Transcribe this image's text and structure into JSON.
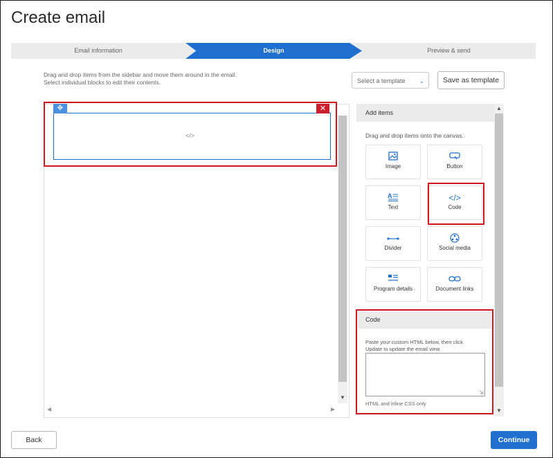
{
  "page": {
    "title": "Create email"
  },
  "stepper": {
    "steps": [
      {
        "label": "Email information"
      },
      {
        "label": "Design"
      },
      {
        "label": "Preview & send"
      }
    ]
  },
  "toolbar": {
    "hint_line1": "Drag and drop items from the sidebar and move them around in the email.",
    "hint_line2": "Select individual blocks to edit their contents.",
    "template_select": "Select a template",
    "save_template": "Save as template"
  },
  "canvas": {
    "block_glyph": "</>",
    "move_glyph": "✥",
    "delete_glyph": "✕"
  },
  "sidebar": {
    "add_items_title": "Add items",
    "drag_hint": "Drag and drop items onto the canvas.",
    "items": [
      {
        "label": "Image",
        "icon": "image-icon"
      },
      {
        "label": "Button",
        "icon": "button-icon"
      },
      {
        "label": "Text",
        "icon": "text-icon"
      },
      {
        "label": "Code",
        "icon": "code-icon"
      },
      {
        "label": "Divider",
        "icon": "divider-icon"
      },
      {
        "label": "Social media",
        "icon": "social-media-icon"
      },
      {
        "label": "Program details",
        "icon": "program-details-icon"
      },
      {
        "label": "Document links",
        "icon": "document-links-icon"
      }
    ],
    "code_panel": {
      "title": "Code",
      "desc_line1": "Paste your custom HTML below, then click",
      "desc_line2": "Update to update the email view.",
      "value": "",
      "note": "HTML and inline CSS only"
    }
  },
  "footer": {
    "back": "Back",
    "continue": "Continue"
  },
  "colors": {
    "accent": "#1f6fd1",
    "highlight": "#d1141e",
    "delete": "#cc1f2e"
  }
}
